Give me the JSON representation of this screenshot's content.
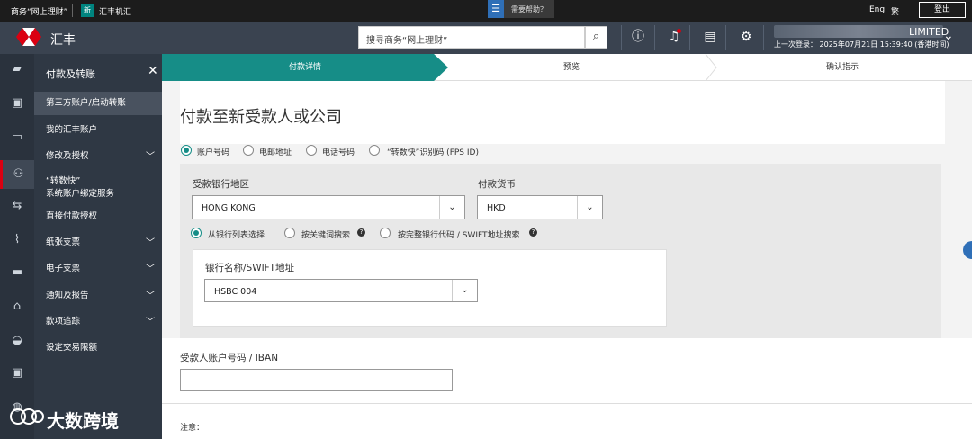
{
  "topbar": {
    "business_label": "商务“网上理财”",
    "badge": "新",
    "hsbcnet_label": "汇丰机汇",
    "help_label": "需要帮助？",
    "lang_en": "Eng",
    "lang_trad": "繁",
    "logout_label": "登出"
  },
  "header": {
    "brand": "汇丰",
    "search_placeholder": "搜寻商务“网上理财”",
    "company_suffix": "LIMITED",
    "last_login": "上一次登录：  2025年07月21日 15:39:40 (香港时间)"
  },
  "sidebar": {
    "title": "付款及转账",
    "items": [
      {
        "label": "第三方账户/启动转账"
      },
      {
        "label": "我的汇丰账户"
      },
      {
        "label": "修改及授权"
      },
      {
        "label": "“转数快”"
      },
      {
        "label": "系统账户绑定服务"
      },
      {
        "label": "直接付款授权"
      },
      {
        "label": "纸张支票"
      },
      {
        "label": "电子支票"
      },
      {
        "label": "通知及报告"
      },
      {
        "label": "款项追踪"
      },
      {
        "label": "设定交易限额"
      }
    ]
  },
  "stepper": {
    "step1": "付款详情",
    "step2": "预览",
    "step3": "确认指示"
  },
  "main": {
    "title": "付款至新受款人或公司",
    "id_types": [
      "账户号码",
      "电邮地址",
      "电话号码",
      "“转数快”识别码 (FPS ID)"
    ],
    "bank_region_label": "受款银行地区",
    "bank_region_value": "HONG KONG",
    "currency_label": "付款货币",
    "currency_value": "HKD",
    "search_options": [
      "从银行列表选择",
      "按关键词搜索",
      "按完整银行代码 / SWIFT地址搜索"
    ],
    "bank_name_label": "银行名称/SWIFT地址",
    "bank_name_value": "HSBC 004",
    "account_label": "受款人账户号码 / IBAN",
    "note_label": "注意："
  },
  "watermark": {
    "text": "大数跨境"
  }
}
